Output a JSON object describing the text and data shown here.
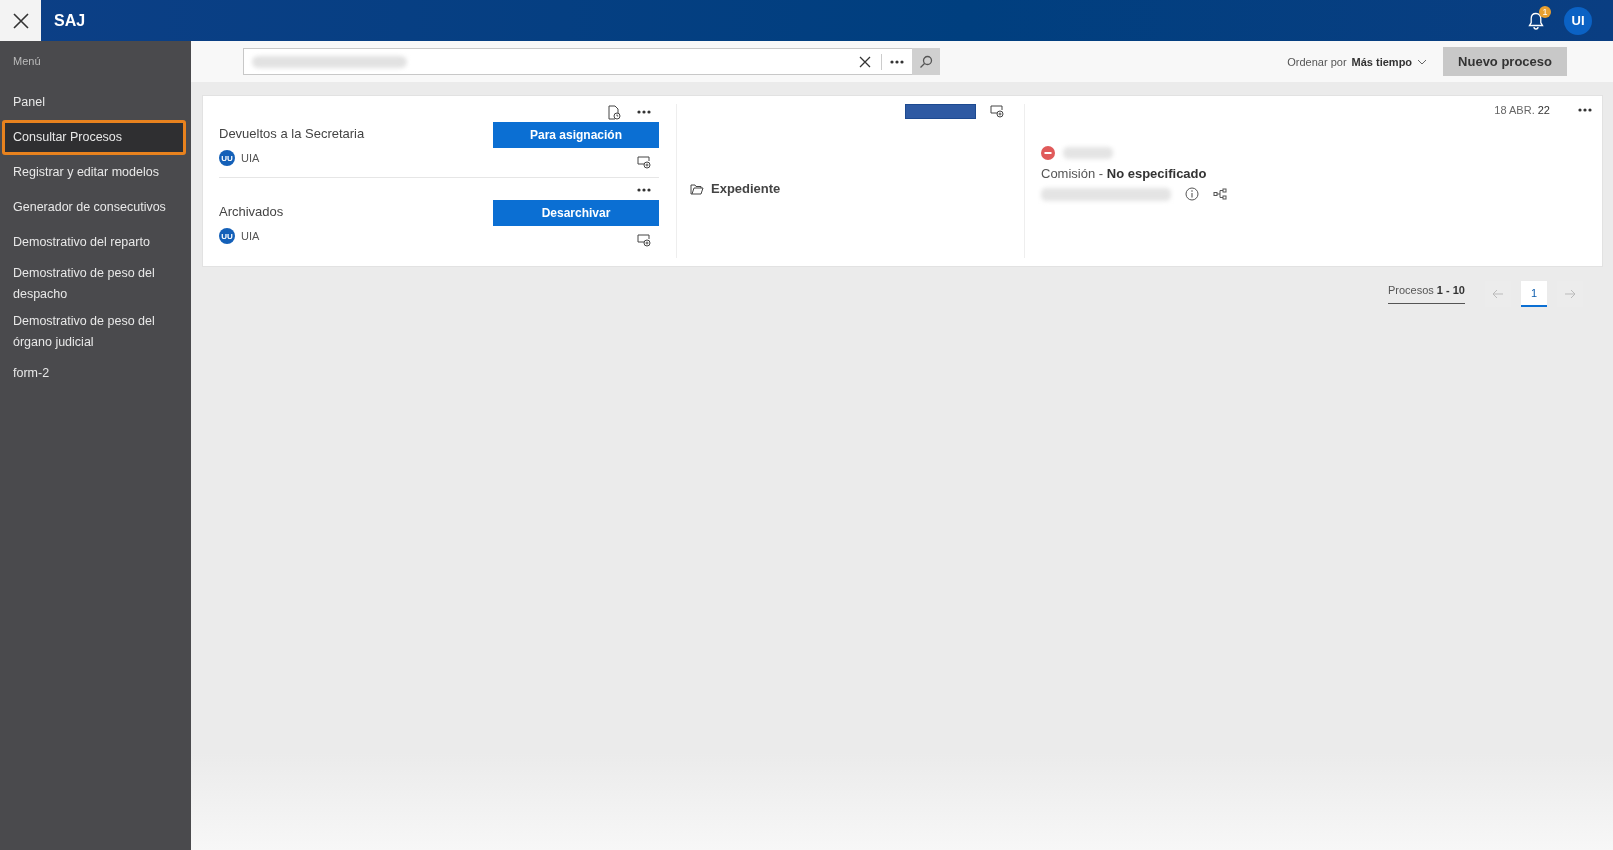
{
  "header": {
    "app_name": "SAJ",
    "notification_count": "1",
    "user_initials": "UI"
  },
  "sidebar": {
    "title": "Menú",
    "items": [
      {
        "label": "Panel",
        "selected": false
      },
      {
        "label": "Consultar Procesos",
        "selected": true
      },
      {
        "label": "Registrar y editar modelos",
        "selected": false
      },
      {
        "label": "Generador de consecutivos",
        "selected": false
      },
      {
        "label": "Demostrativo del reparto",
        "selected": false
      },
      {
        "label": "Demostrativo de peso del despacho",
        "selected": false
      },
      {
        "label": "Demostrativo de peso del órgano judicial",
        "selected": false
      },
      {
        "label": "form-2",
        "selected": false
      }
    ]
  },
  "toolbar": {
    "sort_label": "Ordenar por",
    "sort_value": "Más tiempo",
    "new_button": "Nuevo proceso"
  },
  "card": {
    "groups": [
      {
        "title": "Devueltos a la Secretaria",
        "badge": "UU",
        "owner": "UIA",
        "action": "Para asignación",
        "document_icon": true
      },
      {
        "title": "Archivados",
        "badge": "UU",
        "owner": "UIA",
        "action": "Desarchivar",
        "document_icon": false
      }
    ],
    "folder_label": "Expediente",
    "date": "18 ABR.",
    "year": "22",
    "commission_label": "Comisión",
    "commission_separator": "-",
    "commission_value": "No especificado"
  },
  "pagination": {
    "label": "Procesos",
    "range": "1 - 10",
    "pages": [
      {
        "label": "1",
        "selected": true
      }
    ]
  }
}
